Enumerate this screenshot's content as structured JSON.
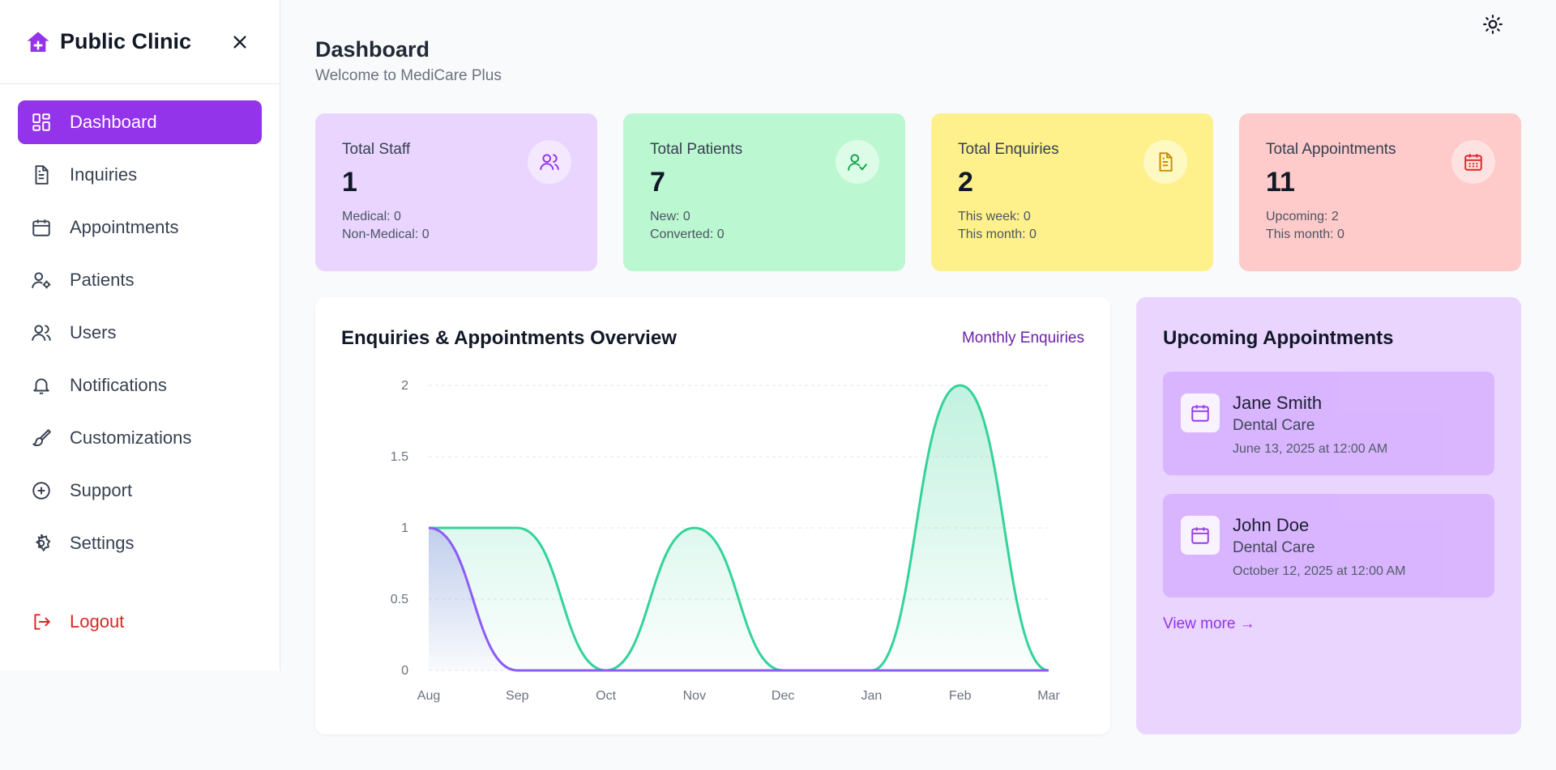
{
  "brand": {
    "name": "Public Clinic"
  },
  "nav": {
    "items": [
      {
        "label": "Dashboard"
      },
      {
        "label": "Inquiries"
      },
      {
        "label": "Appointments"
      },
      {
        "label": "Patients"
      },
      {
        "label": "Users"
      },
      {
        "label": "Notifications"
      },
      {
        "label": "Customizations"
      },
      {
        "label": "Support"
      },
      {
        "label": "Settings"
      }
    ],
    "logout": "Logout"
  },
  "header": {
    "title": "Dashboard",
    "subtitle": "Welcome to MediCare Plus"
  },
  "stats": [
    {
      "label": "Total Staff",
      "value": "1",
      "line1": "Medical: 0",
      "line2": "Non-Medical: 0",
      "bg": "#e9d5ff",
      "icon_bg": "#f3e8ff",
      "icon_color": "#9333ea"
    },
    {
      "label": "Total Patients",
      "value": "7",
      "line1": "New: 0",
      "line2": "Converted: 0",
      "bg": "#bbf7d0",
      "icon_bg": "#dcfce7",
      "icon_color": "#16a34a"
    },
    {
      "label": "Total Enquiries",
      "value": "2",
      "line1": "This week: 0",
      "line2": "This month: 0",
      "bg": "#fef08a",
      "icon_bg": "#fef9c3",
      "icon_color": "#ca8a04"
    },
    {
      "label": "Total Appointments",
      "value": "11",
      "line1": "Upcoming: 2",
      "line2": "This month: 0",
      "bg": "#fecaca",
      "icon_bg": "#fee2e2",
      "icon_color": "#dc2626"
    }
  ],
  "chart": {
    "title": "Enquiries & Appointments Overview",
    "link": "Monthly Enquiries"
  },
  "chart_data": {
    "type": "area",
    "categories": [
      "Aug",
      "Sep",
      "Oct",
      "Nov",
      "Dec",
      "Jan",
      "Feb",
      "Mar"
    ],
    "ylim": [
      0,
      2
    ],
    "yticks": [
      "0",
      "0.5",
      "1",
      "1.5",
      "2"
    ],
    "grid": true,
    "series": [
      {
        "values": [
          1,
          1,
          0,
          1,
          0,
          0,
          2,
          0
        ],
        "color": "#34d399"
      },
      {
        "values": [
          1,
          0,
          0,
          0,
          0,
          0,
          0,
          0
        ],
        "color": "#8b5cf6"
      }
    ]
  },
  "upcoming": {
    "title": "Upcoming Appointments",
    "items": [
      {
        "name": "Jane Smith",
        "service": "Dental Care",
        "date": "June 13, 2025 at 12:00 AM"
      },
      {
        "name": "John Doe",
        "service": "Dental Care",
        "date": "October 12, 2025 at 12:00 AM"
      }
    ],
    "view_more": "View more →"
  },
  "colors": {
    "accent": "#9333ea",
    "danger": "#dc2626"
  }
}
